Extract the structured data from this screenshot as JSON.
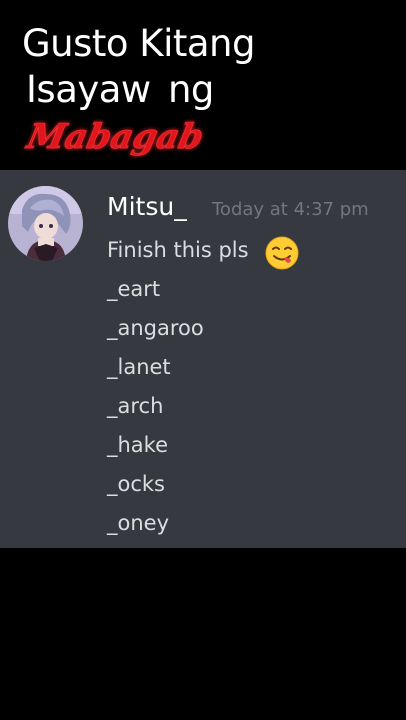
{
  "caption": {
    "line1": "Gusto Kitang",
    "line2": "Isayaw ng",
    "logo_text": "Mabagab",
    "logo_color": "#e0141c"
  },
  "message": {
    "avatar_icon": "anime-avatar-icon",
    "username": "Mitsu_",
    "timestamp": "Today at 4:37 pm",
    "text": "Finish this pls",
    "emoji_icon": "face-savoring-food-emoji",
    "lines": [
      "_eart",
      "_angaroo",
      "_lanet",
      "_arch",
      "_hake",
      "_ocks",
      "_oney"
    ]
  },
  "colors": {
    "background": "#000000",
    "panel": "#36393f",
    "username": "#ffffff",
    "timestamp": "#72767d",
    "message_text": "#dcddde"
  }
}
